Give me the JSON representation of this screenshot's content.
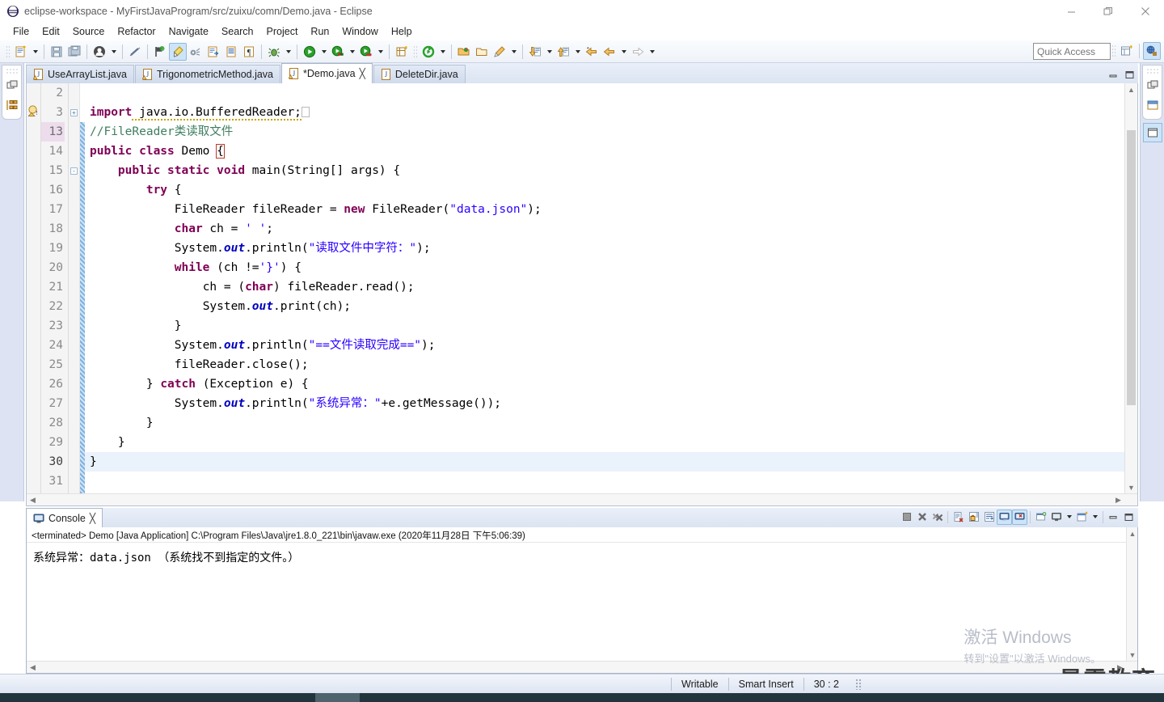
{
  "window": {
    "title": "eclipse-workspace - MyFirstJavaProgram/src/zuixu/comn/Demo.java - Eclipse",
    "icon": "eclipse-icon",
    "controls": {
      "minimize": "minimize-icon",
      "restore": "restore-icon",
      "close": "close-icon"
    }
  },
  "menubar": {
    "items": [
      {
        "label": "File"
      },
      {
        "label": "Edit"
      },
      {
        "label": "Source"
      },
      {
        "label": "Refactor"
      },
      {
        "label": "Navigate"
      },
      {
        "label": "Search"
      },
      {
        "label": "Project"
      },
      {
        "label": "Run"
      },
      {
        "label": "Window"
      },
      {
        "label": "Help"
      }
    ]
  },
  "toolbar": {
    "quick_access_placeholder": "Quick Access",
    "buttons": [
      "new-wizard-icon",
      "save-icon",
      "save-all-icon",
      "skip-breakpoints-icon",
      "toggle-breakpoint-icon",
      "coverage-icon",
      "external-tools-icon",
      "open-type-icon",
      "open-task-icon",
      "toggle-mark-occurrences-icon",
      "debug-icon",
      "run-icon",
      "run-as-icon",
      "coverage-as-icon",
      "new-java-package-icon",
      "run-last-tool-icon",
      "open-resource-icon",
      "open-perspective-icon",
      "annotate-icon",
      "next-annotation-icon",
      "previous-annotation-icon",
      "back-icon",
      "forward-icon"
    ],
    "perspective_buttons": [
      "open-perspective-icon",
      "java-perspective-icon"
    ]
  },
  "editor": {
    "tabs": [
      {
        "label": "UseArrayList.java",
        "active": false,
        "dirty": false,
        "warning": true
      },
      {
        "label": "TrigonometricMethod.java",
        "active": false,
        "dirty": false,
        "warning": true
      },
      {
        "label": "*Demo.java",
        "active": true,
        "dirty": true,
        "warning": true
      },
      {
        "label": "DeleteDir.java",
        "active": false,
        "dirty": false,
        "warning": false
      }
    ],
    "minimize_label": "minimize-icon",
    "maximize_label": "maximize-icon",
    "lines": [
      {
        "num": "2",
        "fold": "",
        "indent": 0,
        "tokens": []
      },
      {
        "num": "3",
        "fold": "+",
        "indent": 0,
        "marker": "warning",
        "tokens": [
          {
            "t": "kw",
            "v": "import"
          },
          {
            "t": "pl",
            "v": " java.io.BufferedReader;"
          },
          {
            "t": "ghost",
            "v": ""
          }
        ]
      },
      {
        "num": "13",
        "fold": "",
        "indent": 0,
        "highlight": true,
        "tokens": [
          {
            "t": "cmt",
            "v": "//FileReader类读取文件"
          }
        ]
      },
      {
        "num": "14",
        "fold": "",
        "indent": 0,
        "tokens": [
          {
            "t": "kw",
            "v": "public class"
          },
          {
            "t": "pl",
            "v": " Demo "
          },
          {
            "t": "match",
            "v": "{"
          }
        ]
      },
      {
        "num": "15",
        "fold": "-",
        "indent": 1,
        "tokens": [
          {
            "t": "kw",
            "v": "public static void"
          },
          {
            "t": "pl",
            "v": " main(String[] args) {"
          }
        ]
      },
      {
        "num": "16",
        "fold": "",
        "indent": 2,
        "tokens": [
          {
            "t": "kw",
            "v": "try"
          },
          {
            "t": "pl",
            "v": " {"
          }
        ]
      },
      {
        "num": "17",
        "fold": "",
        "indent": 3,
        "tokens": [
          {
            "t": "pl",
            "v": "FileReader fileReader = "
          },
          {
            "t": "kw",
            "v": "new"
          },
          {
            "t": "pl",
            "v": " FileReader("
          },
          {
            "t": "str",
            "v": "\"data.json\""
          },
          {
            "t": "pl",
            "v": ");"
          }
        ]
      },
      {
        "num": "18",
        "fold": "",
        "indent": 3,
        "tokens": [
          {
            "t": "kw",
            "v": "char"
          },
          {
            "t": "pl",
            "v": " ch = "
          },
          {
            "t": "str",
            "v": "' '"
          },
          {
            "t": "pl",
            "v": ";"
          }
        ]
      },
      {
        "num": "19",
        "fold": "",
        "indent": 3,
        "tokens": [
          {
            "t": "pl",
            "v": "System."
          },
          {
            "t": "fld",
            "v": "out"
          },
          {
            "t": "pl",
            "v": ".println("
          },
          {
            "t": "str",
            "v": "\"读取文件中字符：\""
          },
          {
            "t": "pl",
            "v": ");"
          }
        ]
      },
      {
        "num": "20",
        "fold": "",
        "indent": 3,
        "tokens": [
          {
            "t": "kw",
            "v": "while"
          },
          {
            "t": "pl",
            "v": " (ch !="
          },
          {
            "t": "str",
            "v": "'}'"
          },
          {
            "t": "pl",
            "v": ") {"
          }
        ]
      },
      {
        "num": "21",
        "fold": "",
        "indent": 4,
        "tokens": [
          {
            "t": "pl",
            "v": "ch = ("
          },
          {
            "t": "kw",
            "v": "char"
          },
          {
            "t": "pl",
            "v": ") fileReader.read();"
          }
        ]
      },
      {
        "num": "22",
        "fold": "",
        "indent": 4,
        "tokens": [
          {
            "t": "pl",
            "v": "System."
          },
          {
            "t": "fld",
            "v": "out"
          },
          {
            "t": "pl",
            "v": ".print(ch);"
          }
        ]
      },
      {
        "num": "23",
        "fold": "",
        "indent": 3,
        "tokens": [
          {
            "t": "pl",
            "v": "}"
          }
        ]
      },
      {
        "num": "24",
        "fold": "",
        "indent": 3,
        "tokens": [
          {
            "t": "pl",
            "v": "System."
          },
          {
            "t": "fld",
            "v": "out"
          },
          {
            "t": "pl",
            "v": ".println("
          },
          {
            "t": "str",
            "v": "\"==文件读取完成==\""
          },
          {
            "t": "pl",
            "v": ");"
          }
        ]
      },
      {
        "num": "25",
        "fold": "",
        "indent": 3,
        "tokens": [
          {
            "t": "pl",
            "v": "fileReader.close();"
          }
        ]
      },
      {
        "num": "26",
        "fold": "",
        "indent": 2,
        "tokens": [
          {
            "t": "pl",
            "v": "} "
          },
          {
            "t": "kw",
            "v": "catch"
          },
          {
            "t": "pl",
            "v": " (Exception e) {"
          }
        ]
      },
      {
        "num": "27",
        "fold": "",
        "indent": 3,
        "tokens": [
          {
            "t": "pl",
            "v": "System."
          },
          {
            "t": "fld",
            "v": "out"
          },
          {
            "t": "pl",
            "v": ".println("
          },
          {
            "t": "str",
            "v": "\"系统异常：\""
          },
          {
            "t": "pl",
            "v": "+e.getMessage());"
          }
        ]
      },
      {
        "num": "28",
        "fold": "",
        "indent": 2,
        "tokens": [
          {
            "t": "pl",
            "v": "}"
          }
        ]
      },
      {
        "num": "29",
        "fold": "",
        "indent": 1,
        "tokens": [
          {
            "t": "pl",
            "v": "}"
          }
        ]
      },
      {
        "num": "30",
        "fold": "",
        "indent": 0,
        "current": true,
        "tokens": [
          {
            "t": "pl",
            "v": "}"
          }
        ]
      },
      {
        "num": "31",
        "fold": "",
        "indent": 0,
        "tokens": []
      }
    ]
  },
  "console": {
    "tab_label": "Console",
    "tab_icon": "console-icon",
    "close_icon": "close-icon",
    "terminated_line": "<terminated> Demo [Java Application] C:\\Program Files\\Java\\jre1.8.0_221\\bin\\javaw.exe (2020年11月28日 下午5:06:39)",
    "output": "系统异常：data.json （系统找不到指定的文件。）",
    "tools": [
      "terminate-icon",
      "remove-launch-icon",
      "remove-all-terminated-icon",
      "clear-console-icon",
      "scroll-lock-icon",
      "word-wrap-icon",
      "show-console-on-output-icon",
      "show-console-on-error-icon",
      "pin-console-icon",
      "display-selected-console-icon",
      "open-console-icon",
      "minimize-icon",
      "maximize-icon"
    ]
  },
  "statusbar": {
    "writable": "Writable",
    "insert_mode": "Smart Insert",
    "position": "30 : 2"
  },
  "watermark": {
    "activate_title": "激活 Windows",
    "activate_subtitle": "转到\"设置\"以激活 Windows。",
    "brand": "最需教育"
  },
  "colors": {
    "keyword": "#7f0055",
    "string": "#2a00ff",
    "comment": "#3f7f5f",
    "field": "#0000c0",
    "accent": "#cde4f8",
    "chrome": "#dde3f2"
  }
}
